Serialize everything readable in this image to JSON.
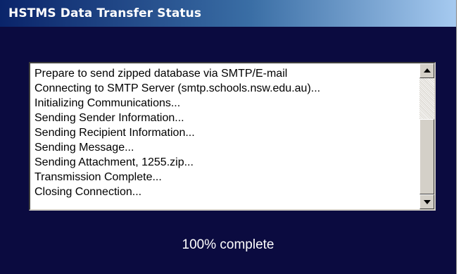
{
  "window": {
    "title": "HSTMS Data Transfer Status"
  },
  "log": {
    "lines": [
      "Prepare to send zipped database via SMTP/E-mail",
      "Connecting to SMTP Server (smtp.schools.nsw.edu.au)...",
      "Initializing Communications...",
      "Sending Sender Information...",
      "Sending Recipient Information...",
      "Sending Message...",
      "Sending Attachment, 1255.zip...",
      "Transmission Complete...",
      "Closing Connection..."
    ]
  },
  "progress": {
    "percent": 100,
    "label": "100% complete"
  },
  "colors": {
    "window_background": "#0b0b40",
    "titlebar_start": "#0a246a",
    "titlebar_end": "#a6caf0"
  },
  "icons": {
    "scroll_up": "arrow-up-icon",
    "scroll_down": "arrow-down-icon"
  }
}
